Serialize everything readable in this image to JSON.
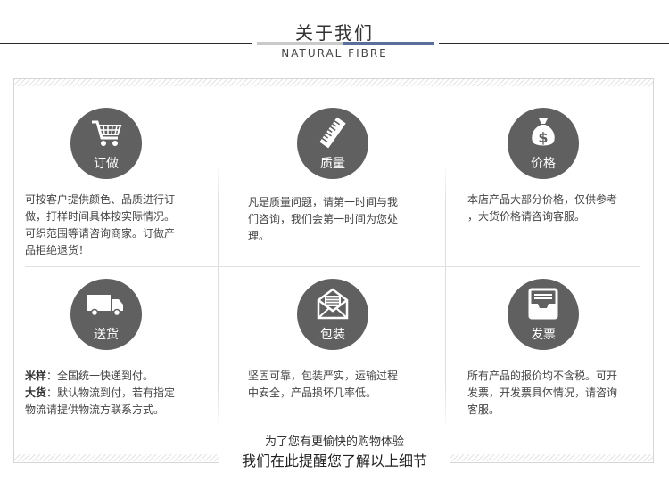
{
  "header": {
    "title": "关于我们",
    "subtitle": "NATURAL FIBRE"
  },
  "cells": [
    {
      "label": "订做",
      "icon": "shopping-cart-icon",
      "lines": [
        "可按客户提供颜色、品质进行订",
        "做，打样时间具体按实际情况。",
        "可织范围等请咨询商家。订做产",
        "品拒绝退货！"
      ]
    },
    {
      "label": "质量",
      "icon": "ruler-icon",
      "lines": [
        "凡是质量问题，请第一时间与我",
        "们咨询，我们会第一时间为您处",
        "理。"
      ]
    },
    {
      "label": "价格",
      "icon": "money-bag-icon",
      "lines": [
        "本店产品大部分价格，仅供参考",
        "，大货价格请咨询客服。"
      ]
    },
    {
      "label": "送货",
      "icon": "truck-icon",
      "items": [
        {
          "key": "米样",
          "text": "：全国统一快递到付。"
        },
        {
          "key": "大货",
          "text": "：默认物流到付，若有指定"
        }
      ],
      "extra": "物流请提供物流方联系方式。"
    },
    {
      "label": "包装",
      "icon": "envelope-icon",
      "lines": [
        "坚固可靠，包装严实，运输过程",
        "中安全，产品损坏几率低。"
      ]
    },
    {
      "label": "发票",
      "icon": "inbox-tray-icon",
      "lines": [
        "所有产品的报价均不含税。可开",
        "发票，开发票具体情况，请咨询",
        "客服。"
      ]
    }
  ],
  "footer": {
    "line1": "为了您有更愉快的购物体验",
    "line2": "我们在此提醒您了解以上细节"
  }
}
